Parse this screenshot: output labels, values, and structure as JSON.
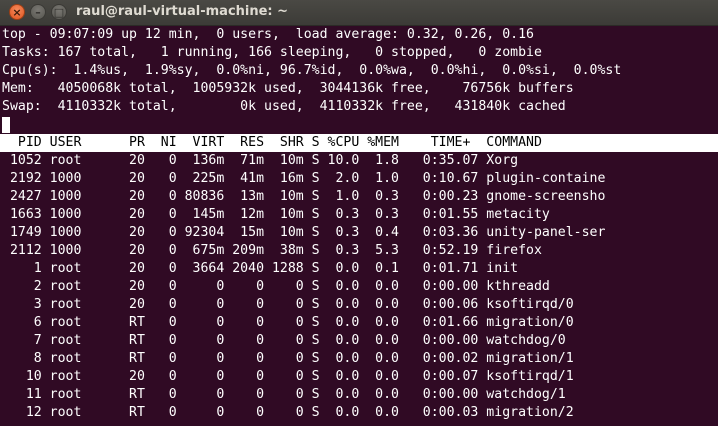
{
  "window": {
    "title": "raul@raul-virtual-machine: ~",
    "close_glyph": "×",
    "minimize_glyph": "–",
    "maximize_glyph": "□"
  },
  "summary": {
    "top_line": "top - 09:07:09 up 12 min,  0 users,  load average: 0.32, 0.26, 0.16",
    "tasks_line": "Tasks: 167 total,   1 running, 166 sleeping,   0 stopped,   0 zombie",
    "cpu_line": "Cpu(s):  1.4%us,  1.9%sy,  0.0%ni, 96.7%id,  0.0%wa,  0.0%hi,  0.0%si,  0.0%st",
    "mem_line": "Mem:   4050068k total,  1005932k used,  3044136k free,    76756k buffers",
    "swap_line": "Swap:  4110332k total,        0k used,  4110332k free,   431840k cached"
  },
  "table": {
    "header": "  PID USER      PR  NI  VIRT  RES  SHR S %CPU %MEM    TIME+  COMMAND",
    "rows": [
      " 1052 root      20   0  136m  71m  10m S 10.0  1.8   0:35.07 Xorg",
      " 2192 1000      20   0  225m  41m  16m S  2.0  1.0   0:10.67 plugin-containe",
      " 2427 1000      20   0 80836  13m  10m S  1.0  0.3   0:00.23 gnome-screensho",
      " 1663 1000      20   0  145m  12m  10m S  0.3  0.3   0:01.55 metacity",
      " 1749 1000      20   0 92304  15m  10m S  0.3  0.4   0:03.36 unity-panel-ser",
      " 2112 1000      20   0  675m 209m  38m S  0.3  5.3   0:52.19 firefox",
      "    1 root      20   0  3664 2040 1288 S  0.0  0.1   0:01.71 init",
      "    2 root      20   0     0    0    0 S  0.0  0.0   0:00.00 kthreadd",
      "    3 root      20   0     0    0    0 S  0.0  0.0   0:00.06 ksoftirqd/0",
      "    6 root      RT   0     0    0    0 S  0.0  0.0   0:01.66 migration/0",
      "    7 root      RT   0     0    0    0 S  0.0  0.0   0:00.00 watchdog/0",
      "    8 root      RT   0     0    0    0 S  0.0  0.0   0:00.02 migration/1",
      "   10 root      20   0     0    0    0 S  0.0  0.0   0:00.07 ksoftirqd/1",
      "   11 root      RT   0     0    0    0 S  0.0  0.0   0:00.00 watchdog/1",
      "   12 root      RT   0     0    0    0 S  0.0  0.0   0:00.03 migration/2"
    ]
  }
}
